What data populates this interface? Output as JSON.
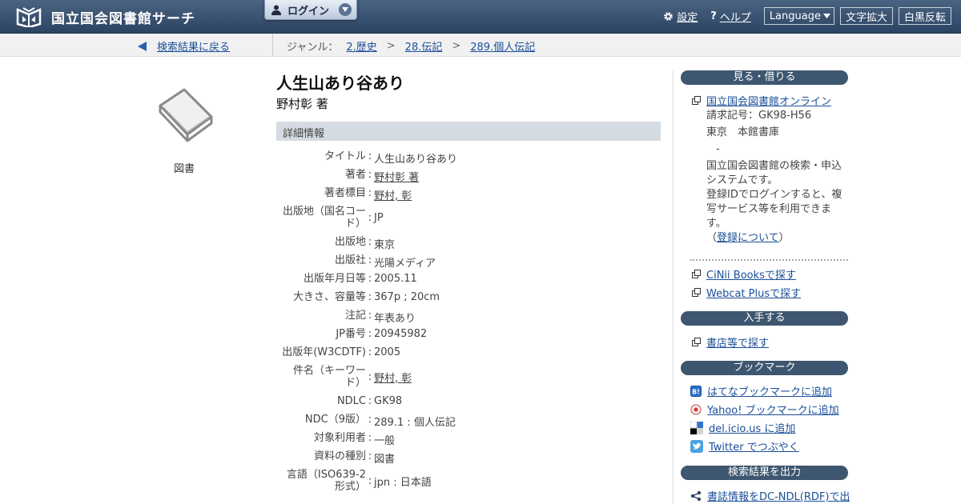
{
  "header": {
    "site_title": "国立国会図書館サーチ",
    "login_label": "ログイン",
    "settings_label": "設定",
    "help_label": "ヘルプ",
    "language_label": "Language",
    "zoom_label": "文字拡大",
    "invert_label": "白黒反転"
  },
  "breadcrumb": {
    "back_label": "検索結果に戻る",
    "genre_label": "ジャンル：",
    "genre": [
      "2.歴史",
      "28.伝記",
      "289.個人伝記"
    ],
    "separator": ">"
  },
  "item": {
    "type_label": "図書",
    "title": "人生山あり谷あり",
    "author": "野村彰 著",
    "detail_heading": "詳細情報",
    "details": [
      {
        "label": "タイトル",
        "value": "人生山あり谷あり",
        "link": false
      },
      {
        "label": "著者",
        "value": "野村彰 著",
        "link": true
      },
      {
        "label": "著者標目",
        "value": "野村, 彰",
        "link": true
      },
      {
        "label1": "出版地（国名コー",
        "label2": "ド）",
        "value": "JP",
        "link": false
      },
      {
        "label": "出版地",
        "value": "東京",
        "link": false
      },
      {
        "label": "出版社",
        "value": "光陽メディア",
        "link": false
      },
      {
        "label": "出版年月日等",
        "value": "2005.11",
        "link": false
      },
      {
        "label": "大きさ、容量等",
        "value": "367p ; 20cm",
        "link": false
      },
      {
        "label": "注記",
        "value": "年表あり",
        "link": false
      },
      {
        "label": "JP番号",
        "value": "20945982",
        "link": false
      },
      {
        "label": "出版年(W3CDTF)",
        "value": "2005",
        "link": false
      },
      {
        "label1": "件名（キーワー",
        "label2": "ド）",
        "value": "野村, 彰",
        "link": true
      },
      {
        "label": "NDLC",
        "value": "GK98",
        "link": false
      },
      {
        "label": "NDC（9版）",
        "value": "289.1 : 個人伝記",
        "link": false
      },
      {
        "label": "対象利用者",
        "value": "一般",
        "link": false
      },
      {
        "label": "資料の種別",
        "value": "図書",
        "link": false
      },
      {
        "label1": "言語（ISO639-2",
        "label2": "形式）",
        "value": "jpn : 日本語",
        "link": false
      }
    ]
  },
  "sidebar": {
    "see_borrow": {
      "heading": "見る・借りる",
      "ndl_online": "国立国会図書館オンライン",
      "call_number": "請求記号：GK98-H56",
      "location": "東京　本館書庫",
      "dash": "-",
      "desc1": "国立国会図書館の検索・申込",
      "desc2": "システムです。",
      "desc3": "登録IDでログインすると、複",
      "desc4": "写サービス等を利用できま",
      "desc5": "す。",
      "reg_open": "（",
      "reg_link": "登録について",
      "reg_close": "）",
      "cinii": "CiNii Booksで探す",
      "webcat": "Webcat Plusで探す"
    },
    "obtain": {
      "heading": "入手する",
      "bookstore": "書店等で探す"
    },
    "bookmark": {
      "heading": "ブックマーク",
      "hatena": "はてなブックマークに追加",
      "yahoo": "Yahoo! ブックマークに追加",
      "delicious": "del.icio.us に追加",
      "twitter": "Twitter でつぶやく"
    },
    "export": {
      "heading": "検索結果を出力",
      "rdf": "書誌情報をDC-NDL(RDF)で出"
    }
  }
}
